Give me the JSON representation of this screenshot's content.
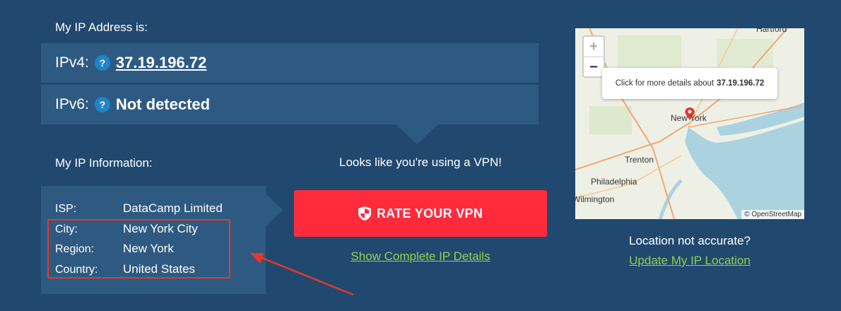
{
  "ip_section": {
    "heading": "My IP Address is:",
    "ipv4_label": "IPv4:",
    "ipv4_value": "37.19.196.72",
    "ipv6_label": "IPv6:",
    "ipv6_value": "Not detected",
    "help": "?"
  },
  "info_section": {
    "heading": "My IP Information:",
    "rows": [
      {
        "key": "ISP:",
        "value": "DataCamp Limited"
      },
      {
        "key": "City:",
        "value": "New York City"
      },
      {
        "key": "Region:",
        "value": "New York"
      },
      {
        "key": "Country:",
        "value": "United States"
      }
    ]
  },
  "vpn": {
    "message": "Looks like you're using a VPN!",
    "rate_button": "RATE YOUR VPN",
    "details_link": "Show Complete IP Details"
  },
  "map": {
    "zoom_in": "+",
    "zoom_out": "−",
    "popup_text": "Click for more details about",
    "popup_ip": "37.19.196.72",
    "cities": [
      "Hartford",
      "New York",
      "Trenton",
      "Philadelphia",
      "Wilmington"
    ],
    "attribution": "© OpenStreetMap"
  },
  "location": {
    "question": "Location not accurate?",
    "update_link": "Update My IP Location"
  },
  "colors": {
    "background": "#21496f",
    "panel": "#2e5a82",
    "button": "#ff2b3d",
    "link": "#8fd14f",
    "highlight": "#e8372a"
  }
}
